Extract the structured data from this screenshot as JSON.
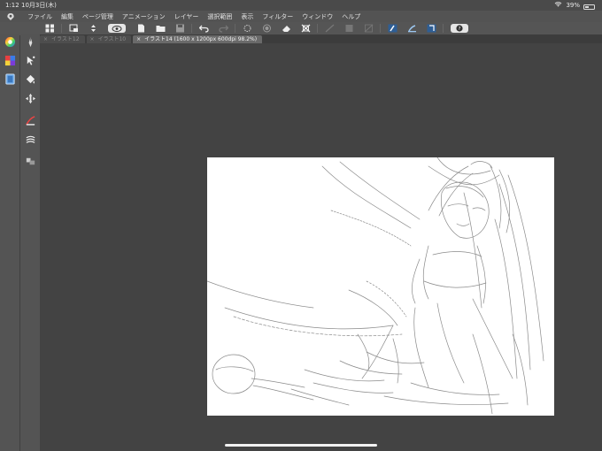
{
  "status": {
    "time": "1:12",
    "date": "10月3日(木)",
    "battery": "39%",
    "battery_level": 0.39
  },
  "menu": {
    "app_icon": "clip-studio-logo-icon",
    "items": [
      "ファイル",
      "編集",
      "ページ管理",
      "アニメーション",
      "レイヤー",
      "選択範囲",
      "表示",
      "フィルター",
      "ウィンドウ",
      "ヘルプ"
    ]
  },
  "toolbar": {
    "icons": [
      "grid-icon",
      "new-file-icon",
      "stepper-icon",
      "clip-eye-icon",
      "document-icon",
      "folder-icon",
      "save-icon",
      "undo-icon",
      "redo-icon",
      "transform-icon",
      "loading-icon",
      "eraser-icon",
      "crop-icon",
      "snap-ruler-icon",
      "snap-grid-icon",
      "snap-curve-icon",
      "pen-layer-icon",
      "brush-layer-icon",
      "palette-layer-icon",
      "help-icon"
    ]
  },
  "tabs": [
    {
      "label": "イラスト12",
      "active": false
    },
    {
      "label": "イラスト10",
      "active": false
    },
    {
      "label": "イラスト14 (1600 x 1200px 600dpi 98.2%)",
      "active": true
    }
  ],
  "left": {
    "nav_arrows": [
      "«",
      "‹",
      "›",
      "»"
    ],
    "icons": [
      "color-wheel-icon",
      "pen-tool-icon",
      "color-set-icon",
      "select-tool-icon",
      "layers-panel-icon",
      "fill-tool-icon",
      "gradient-tool-icon",
      "move-layer-icon",
      "stroke-icon",
      "eraser-tool-icon",
      "texture-icon",
      "transform-tool-icon"
    ]
  },
  "colors": {
    "background": "#434343",
    "menubar": "#535353",
    "canvas": "#ffffff",
    "active_tab": "#6a6a6a"
  }
}
